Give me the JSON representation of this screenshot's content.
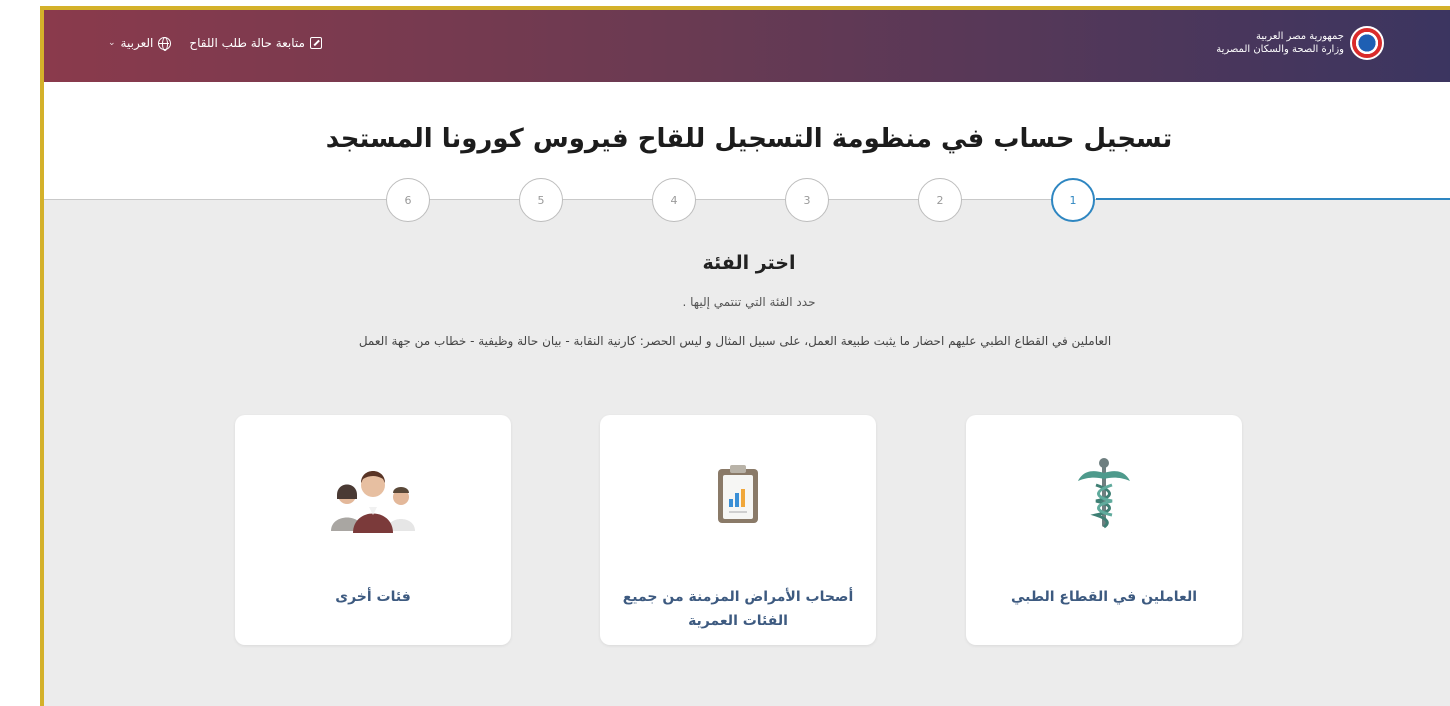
{
  "header": {
    "brand_line1": "جمهورية مصر العربية",
    "brand_line2": "وزارة الصحة والسكان المصرية",
    "nav_track": "متابعة حالة طلب اللقاح",
    "nav_language": "العربية"
  },
  "page": {
    "title": "تسجيل حساب في منظومة التسجيل للقاح فيروس كورونا المستجد"
  },
  "steps": [
    "1",
    "2",
    "3",
    "4",
    "5",
    "6"
  ],
  "active_step": 1,
  "section": {
    "title": "اختر الفئة",
    "subtitle": "حدد الفئة التي تنتمي إليها .",
    "note": "العاملين في القطاع الطبي عليهم احضار ما يثبت طبيعة العمل، على سبيل المثال و ليس الحصر: كارنية النقابة - بيان حالة وظيفية - خطاب من جهة العمل"
  },
  "categories": [
    {
      "label": "العاملين في القطاع الطبي",
      "icon": "caduceus-icon"
    },
    {
      "label": "أصحاب الأمراض المزمنة من جميع الفئات العمرية",
      "icon": "clipboard-chart-icon"
    },
    {
      "label": "فئات أخرى",
      "icon": "people-group-icon"
    }
  ],
  "colors": {
    "accent": "#2e86c1",
    "card_label": "#3d5a80",
    "frame_border": "#d4b12a"
  }
}
